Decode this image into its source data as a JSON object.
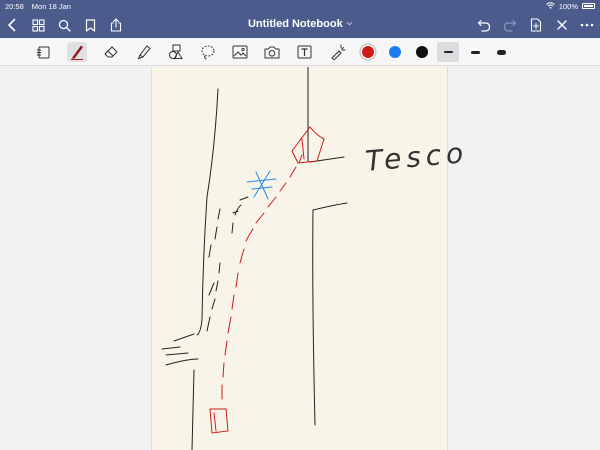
{
  "status": {
    "time": "20:58",
    "date": "Mon 18 Jan",
    "battery": "100%"
  },
  "nav": {
    "title": "Untitled Notebook",
    "icons": [
      "chevron-left-icon",
      "grid-icon",
      "search-icon",
      "bookmark-icon",
      "share-icon",
      "undo-icon",
      "redo-icon",
      "add-page-icon",
      "close-icon",
      "more-icon"
    ]
  },
  "toolbar": {
    "tools": [
      "sidebar-icon",
      "pen-icon",
      "eraser-icon",
      "highlighter-icon",
      "shapes-icon",
      "lasso-icon",
      "image-icon",
      "camera-icon",
      "text-icon",
      "laser-icon"
    ],
    "colors": [
      "#d11b1b",
      "#1a7cf0",
      "#111111"
    ]
  },
  "canvas": {
    "note_text": "Tesco"
  }
}
